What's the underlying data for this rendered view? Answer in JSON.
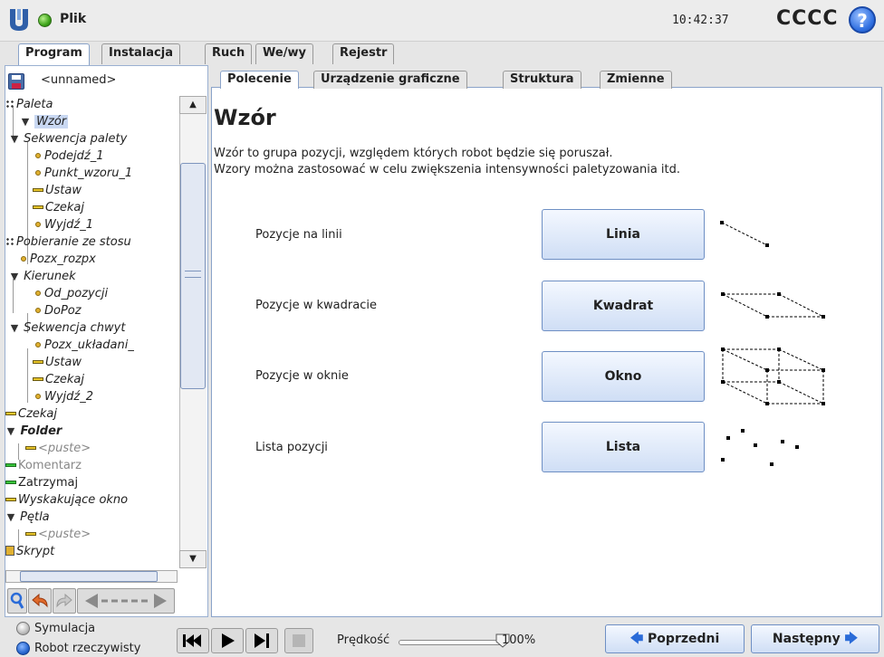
{
  "header": {
    "file_menu": "Plik",
    "clock": "10:42:37",
    "robot_name": "CCCC",
    "help_icon": "question-circle-icon"
  },
  "main_tabs": [
    "Program",
    "Instalacja",
    "Ruch",
    "We/wy",
    "Rejestr"
  ],
  "file": {
    "name": "<unnamed>"
  },
  "sub_tabs": [
    "Polecenie",
    "Urządzenie graficzne",
    "Struktura",
    "Zmienne"
  ],
  "tree": [
    {
      "label": "Paleta"
    },
    {
      "label": "Wzór"
    },
    {
      "label": "Sekwencja palety"
    },
    {
      "label": "Podejdź_1"
    },
    {
      "label": "Punkt_wzoru_1"
    },
    {
      "label": "Ustaw"
    },
    {
      "label": "Czekaj"
    },
    {
      "label": "Wyjdź_1"
    },
    {
      "label": "Pobieranie ze stosu"
    },
    {
      "label": "Pozx_rozpx"
    },
    {
      "label": "Kierunek"
    },
    {
      "label": "Od_pozycji"
    },
    {
      "label": "DoPoz"
    },
    {
      "label": "Sekwencja chwyt"
    },
    {
      "label": "Pozx_układani_"
    },
    {
      "label": "Ustaw"
    },
    {
      "label": "Czekaj"
    },
    {
      "label": "Wyjdź_2"
    },
    {
      "label": "Czekaj"
    },
    {
      "label": "Folder"
    },
    {
      "label": "<puste>"
    },
    {
      "label": "Komentarz"
    },
    {
      "label": "Zatrzymaj"
    },
    {
      "label": "Wyskakujące okno"
    },
    {
      "label": "Pętla"
    },
    {
      "label": "<puste>"
    },
    {
      "label": "Skrypt"
    }
  ],
  "content": {
    "title": "Wzór",
    "description_line1": "Wzór to grupa pozycji, względem których robot będzie się poruszał.",
    "description_line2": "Wzory można zastosować w celu zwiększenia intensywności paletyzowania itd.",
    "rows": [
      {
        "label": "Pozycje na linii",
        "button": "Linia"
      },
      {
        "label": "Pozycje w kwadracie",
        "button": "Kwadrat"
      },
      {
        "label": "Pozycje w oknie",
        "button": "Okno"
      },
      {
        "label": "Lista pozycji",
        "button": "Lista"
      }
    ]
  },
  "bottom": {
    "simulation": "Symulacja",
    "real_robot": "Robot rzeczywisty",
    "speed_label": "Prędkość",
    "speed_value": "100%",
    "speed_fraction": 1.0,
    "prev": "Poprzedni",
    "next": "Następny"
  }
}
